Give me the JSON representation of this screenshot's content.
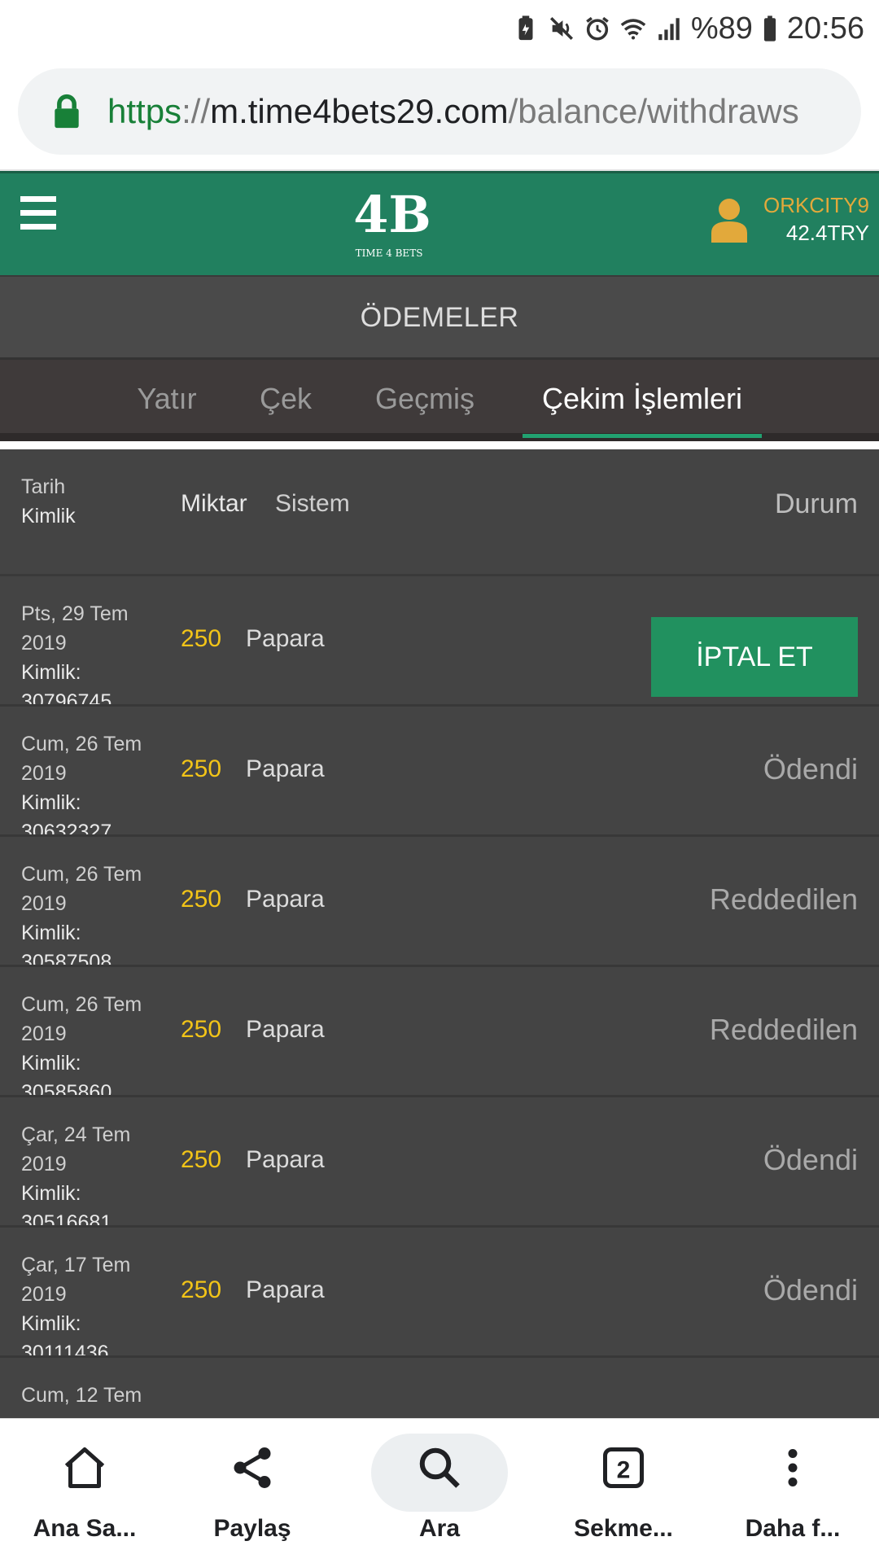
{
  "status_bar": {
    "battery": "%89",
    "time": "20:56"
  },
  "url_bar": {
    "scheme": "https",
    "separator": "://",
    "host": "m.time4bets29.com",
    "path": "/balance/withdraws"
  },
  "header": {
    "logo_mark": "4B",
    "logo_text": "TIME 4 BETS",
    "username": "ORKCITY9",
    "balance": "42.4TRY",
    "brand_color": "#21805f"
  },
  "page_title": "ÖDEMELER",
  "tabs": [
    {
      "label": "Yatır"
    },
    {
      "label": "Çek"
    },
    {
      "label": "Geçmiş"
    },
    {
      "label": "Çekim İşlemleri",
      "active": true
    }
  ],
  "table": {
    "headers": {
      "tarih": "Tarih",
      "kimlik": "Kimlik",
      "miktar": "Miktar",
      "sistem": "Sistem",
      "durum": "Durum"
    },
    "rows": [
      {
        "date1": "Pts, 29 Tem",
        "date2": "2019",
        "kimlik_label": "Kimlik:",
        "kimlik": "30796745",
        "amount": "250",
        "system": "Papara",
        "status": "İPTAL ET",
        "is_button": true
      },
      {
        "date1": "Cum, 26 Tem",
        "date2": "2019",
        "kimlik_label": "Kimlik:",
        "kimlik": "30632327",
        "amount": "250",
        "system": "Papara",
        "status": "Ödendi"
      },
      {
        "date1": "Cum, 26 Tem",
        "date2": "2019",
        "kimlik_label": "Kimlik:",
        "kimlik": "30587508",
        "amount": "250",
        "system": "Papara",
        "status": "Reddedilen"
      },
      {
        "date1": "Cum, 26 Tem",
        "date2": "2019",
        "kimlik_label": "Kimlik:",
        "kimlik": "30585860",
        "amount": "250",
        "system": "Papara",
        "status": "Reddedilen"
      },
      {
        "date1": "Çar, 24 Tem",
        "date2": "2019",
        "kimlik_label": "Kimlik:",
        "kimlik": "30516681",
        "amount": "250",
        "system": "Papara",
        "status": "Ödendi"
      },
      {
        "date1": "Çar, 17 Tem",
        "date2": "2019",
        "kimlik_label": "Kimlik:",
        "kimlik": "30111436",
        "amount": "250",
        "system": "Papara",
        "status": "Ödendi"
      },
      {
        "date1": "Cum, 12 Tem",
        "date2": "",
        "kimlik_label": "",
        "kimlik": "",
        "amount": "",
        "system": "",
        "status": ""
      }
    ]
  },
  "bottom_nav": [
    {
      "label": "Ana Sa...",
      "icon": "home-icon"
    },
    {
      "label": "Paylaş",
      "icon": "share-icon"
    },
    {
      "label": "Ara",
      "icon": "search-icon"
    },
    {
      "label": "Sekme...",
      "icon": "tabs-icon",
      "count": "2"
    },
    {
      "label": "Daha f...",
      "icon": "more-icon"
    }
  ]
}
